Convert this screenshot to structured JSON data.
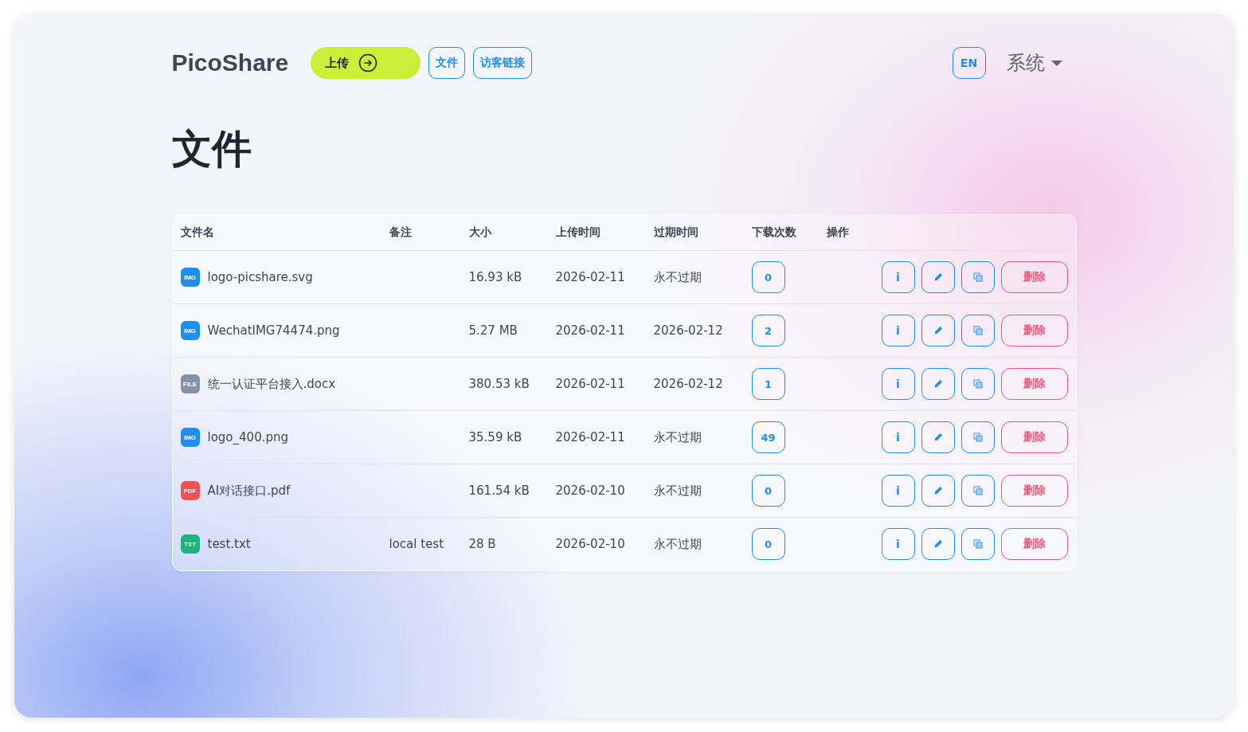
{
  "brand": "PicoShare",
  "nav": {
    "upload": {
      "label": "上传"
    },
    "links": [
      {
        "label": "文件"
      },
      {
        "label": "访客链接"
      }
    ],
    "lang": "EN",
    "system": "系统"
  },
  "heading": "文件",
  "table": {
    "columns": [
      "文件名",
      "备注",
      "大小",
      "上传时间",
      "过期时间",
      "下载次数",
      "操作"
    ],
    "rows": [
      {
        "type": "IMG",
        "color": "#1f8ef1",
        "name": "logo-picshare.svg",
        "note": "",
        "size": "16.93 kB",
        "uploaded": "2026-02-11",
        "expires": "永不过期",
        "downloads": "0",
        "info": "i",
        "delete": "删除"
      },
      {
        "type": "IMG",
        "color": "#1f8ef1",
        "name": "WechatIMG74474.png",
        "note": "",
        "size": "5.27 MB",
        "uploaded": "2026-02-11",
        "expires": "2026-02-12",
        "downloads": "2",
        "info": "i",
        "delete": "删除"
      },
      {
        "type": "FILE",
        "color": "#8593a8",
        "name": "统一认证平台接入.docx",
        "note": "",
        "size": "380.53 kB",
        "uploaded": "2026-02-11",
        "expires": "2026-02-12",
        "downloads": "1",
        "info": "i",
        "delete": "删除"
      },
      {
        "type": "IMG",
        "color": "#1f8ef1",
        "name": "logo_400.png",
        "note": "",
        "size": "35.59 kB",
        "uploaded": "2026-02-11",
        "expires": "永不过期",
        "downloads": "49",
        "info": "i",
        "delete": "删除"
      },
      {
        "type": "PDF",
        "color": "#f0525a",
        "name": "AI对话接口.pdf",
        "note": "",
        "size": "161.54 kB",
        "uploaded": "2026-02-10",
        "expires": "永不过期",
        "downloads": "0",
        "info": "i",
        "delete": "删除"
      },
      {
        "type": "TXT",
        "color": "#22b07d",
        "name": "test.txt",
        "note": "local test",
        "size": "28 B",
        "uploaded": "2026-02-10",
        "expires": "永不过期",
        "downloads": "0",
        "info": "i",
        "delete": "删除"
      }
    ]
  }
}
